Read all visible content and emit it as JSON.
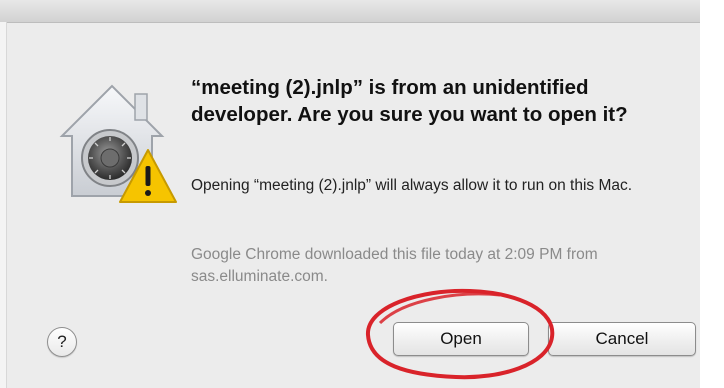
{
  "dialog": {
    "headline": "“meeting (2).jnlp” is from an unidentified developer. Are you sure you want to open it?",
    "info": "Opening “meeting (2).jnlp” will always allow it to run on this Mac.",
    "source": "Google Chrome downloaded this file today at 2:09 PM from sas.elluminate.com.",
    "help_label": "?",
    "open_label": "Open",
    "cancel_label": "Cancel"
  },
  "colors": {
    "annotation_circle": "#d9232a",
    "warning": "#f6c400"
  },
  "icons": {
    "app_icon": "gatekeeper-lock-icon",
    "warning_badge": "warning-icon"
  }
}
